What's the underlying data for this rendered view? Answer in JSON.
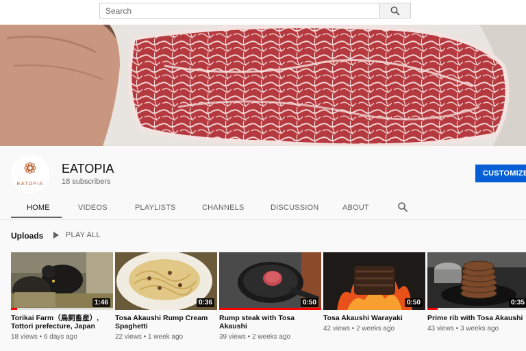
{
  "search": {
    "placeholder": "Search",
    "icon": "search-icon"
  },
  "channel": {
    "name": "EATOPIA",
    "subscribers": "18 subscribers",
    "logo_text": "EATOPIA",
    "customize_label": "CUSTOMIZE CHANNEL"
  },
  "tabs": [
    {
      "label": "HOME",
      "active": true
    },
    {
      "label": "VIDEOS"
    },
    {
      "label": "PLAYLISTS"
    },
    {
      "label": "CHANNELS"
    },
    {
      "label": "DISCUSSION"
    },
    {
      "label": "ABOUT"
    }
  ],
  "uploads": {
    "title": "Uploads",
    "play_all": "PLAY ALL",
    "videos": [
      {
        "title": "Torikai Farm（鳥飼畜産）, Tottori prefecture, Japan",
        "meta": "18 views • 6 days ago",
        "duration": "1:46",
        "progress": 0.06
      },
      {
        "title": "Tosa Akaushi Rump Cream Spaghetti",
        "meta": "22 views • 1 week ago",
        "duration": "0:36",
        "progress": 0.0
      },
      {
        "title": "Rump steak with Tosa Akaushi",
        "meta": "39 views • 2 weeks ago",
        "duration": "0:50",
        "progress": 1.0
      },
      {
        "title": "Tosa Akaushi Warayaki",
        "meta": "42 views • 2 weeks ago",
        "duration": "0:50",
        "progress": 0.0
      },
      {
        "title": "Prime rib with Tosa Akaushi",
        "meta": "43 views • 3 weeks ago",
        "duration": "0:35",
        "progress": 0.1
      }
    ]
  },
  "colors": {
    "accent_blue": "#065fd4",
    "progress_red": "#ff0000",
    "logo_gold": "#b8653a"
  }
}
